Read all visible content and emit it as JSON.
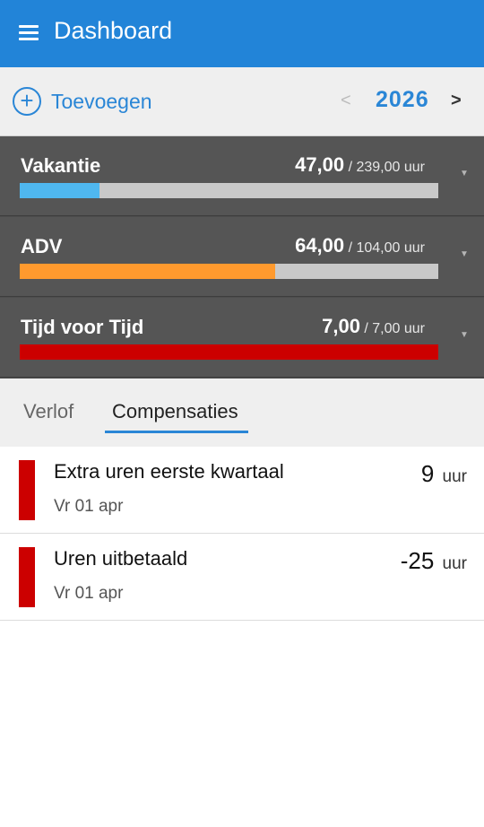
{
  "appbar": {
    "title": "Dashboard"
  },
  "toolbar": {
    "add_label": "Toevoegen",
    "add_symbol": "+",
    "prev": "<",
    "year": "2026",
    "next": ">"
  },
  "balances": [
    {
      "name": "Vakantie",
      "used": "47,00",
      "total": "/ 239,00 uur",
      "fraction": 0.19,
      "color": "#4fb7ef",
      "arrow": "▼"
    },
    {
      "name": "ADV",
      "used": "64,00",
      "total": "/ 104,00 uur",
      "fraction": 0.61,
      "color": "#ff9a2e",
      "arrow": "▼"
    },
    {
      "name": "Tijd voor Tijd",
      "used": "7,00",
      "total": "/ 7,00 uur",
      "fraction": 1.0,
      "color": "#cc0000",
      "arrow": "▼"
    }
  ],
  "tabs": {
    "verlof": "Verlof",
    "compensaties": "Compensaties",
    "active": "compensaties"
  },
  "entries": [
    {
      "title": "Extra uren eerste kwartaal",
      "date": "Vr 01 apr",
      "amount": "9",
      "unit": "uur",
      "color": "#cc0000"
    },
    {
      "title": "Uren uitbetaald",
      "date": "Vr 01 apr",
      "amount": "-25",
      "unit": "uur",
      "color": "#cc0000"
    }
  ]
}
